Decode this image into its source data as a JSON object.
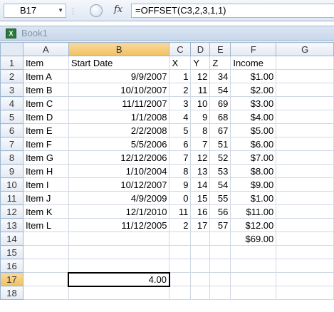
{
  "formula_bar": {
    "name_box": "B17",
    "fx_label": "fx",
    "formula": "=OFFSET(C3,2,3,1,1)"
  },
  "workbook": {
    "title": "Book1",
    "icon_label": "X"
  },
  "columns": [
    "A",
    "B",
    "C",
    "D",
    "E",
    "F",
    "G"
  ],
  "rows": [
    {
      "n": "1",
      "cells": [
        "Item",
        "Start Date",
        "X",
        "Y",
        "Z",
        "Income",
        ""
      ]
    },
    {
      "n": "2",
      "cells": [
        "Item A",
        "9/9/2007",
        "1",
        "12",
        "34",
        "$1.00",
        ""
      ]
    },
    {
      "n": "3",
      "cells": [
        "Item B",
        "10/10/2007",
        "2",
        "11",
        "54",
        "$2.00",
        ""
      ]
    },
    {
      "n": "4",
      "cells": [
        "Item C",
        "11/11/2007",
        "3",
        "10",
        "69",
        "$3.00",
        ""
      ]
    },
    {
      "n": "5",
      "cells": [
        "Item D",
        "1/1/2008",
        "4",
        "9",
        "68",
        "$4.00",
        ""
      ]
    },
    {
      "n": "6",
      "cells": [
        "Item E",
        "2/2/2008",
        "5",
        "8",
        "67",
        "$5.00",
        ""
      ]
    },
    {
      "n": "7",
      "cells": [
        "Item F",
        "5/5/2006",
        "6",
        "7",
        "51",
        "$6.00",
        ""
      ]
    },
    {
      "n": "8",
      "cells": [
        "Item G",
        "12/12/2006",
        "7",
        "12",
        "52",
        "$7.00",
        ""
      ]
    },
    {
      "n": "9",
      "cells": [
        "Item H",
        "1/10/2004",
        "8",
        "13",
        "53",
        "$8.00",
        ""
      ]
    },
    {
      "n": "10",
      "cells": [
        "Item I",
        "10/12/2007",
        "9",
        "14",
        "54",
        "$9.00",
        ""
      ]
    },
    {
      "n": "11",
      "cells": [
        "Item J",
        "4/9/2009",
        "0",
        "15",
        "55",
        "$1.00",
        ""
      ]
    },
    {
      "n": "12",
      "cells": [
        "Item K",
        "12/1/2010",
        "11",
        "16",
        "56",
        "$11.00",
        ""
      ]
    },
    {
      "n": "13",
      "cells": [
        "Item L",
        "11/12/2005",
        "2",
        "17",
        "57",
        "$12.00",
        ""
      ]
    },
    {
      "n": "14",
      "cells": [
        "",
        "",
        "",
        "",
        "",
        "$69.00",
        ""
      ]
    },
    {
      "n": "15",
      "cells": [
        "",
        "",
        "",
        "",
        "",
        "",
        ""
      ]
    },
    {
      "n": "16",
      "cells": [
        "",
        "",
        "",
        "",
        "",
        "",
        ""
      ]
    },
    {
      "n": "17",
      "cells": [
        "",
        "4.00",
        "",
        "",
        "",
        "",
        ""
      ]
    },
    {
      "n": "18",
      "cells": [
        "",
        "",
        "",
        "",
        "",
        "",
        ""
      ]
    }
  ],
  "colors": {
    "selected_header": "#f1c15f",
    "grid_line": "#d0d7e5",
    "header_bg": "#e3eaf4"
  }
}
